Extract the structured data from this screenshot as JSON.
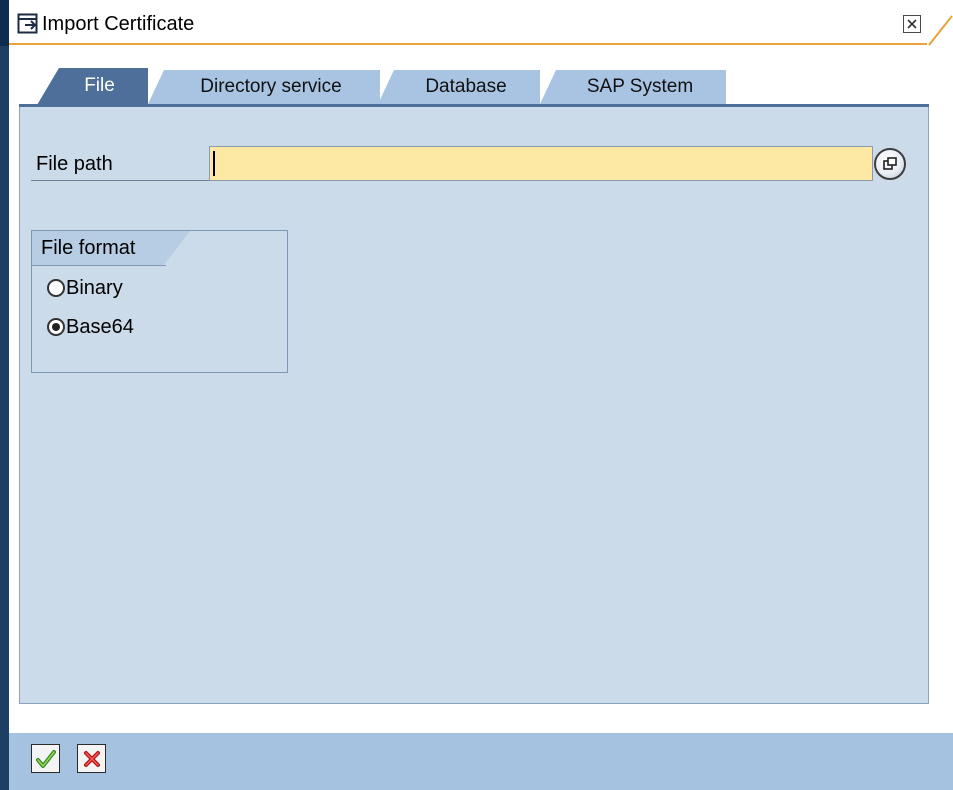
{
  "window": {
    "title": "Import Certificate",
    "icon": "import-dialog-icon",
    "close_icon": "close-icon"
  },
  "tabs": [
    {
      "label": "File",
      "active": true
    },
    {
      "label": "Directory service",
      "active": false
    },
    {
      "label": "Database",
      "active": false
    },
    {
      "label": "SAP System",
      "active": false
    }
  ],
  "file_path": {
    "label": "File path",
    "value": "",
    "help_icon": "value-help-icon"
  },
  "file_format": {
    "title": "File format",
    "options": [
      {
        "label": "Binary",
        "selected": false
      },
      {
        "label": "Base64",
        "selected": true
      }
    ]
  },
  "toolbar": {
    "ok_icon": "checkmark-icon",
    "cancel_icon": "cancel-icon"
  },
  "colors": {
    "active_tab": "#4d6f9a",
    "inactive_tab": "#a9c4e3",
    "panel": "#ccdbe9",
    "input_required": "#fde9a4",
    "title_accent": "#e8a33a",
    "toolbar": "#a6c2e1"
  }
}
